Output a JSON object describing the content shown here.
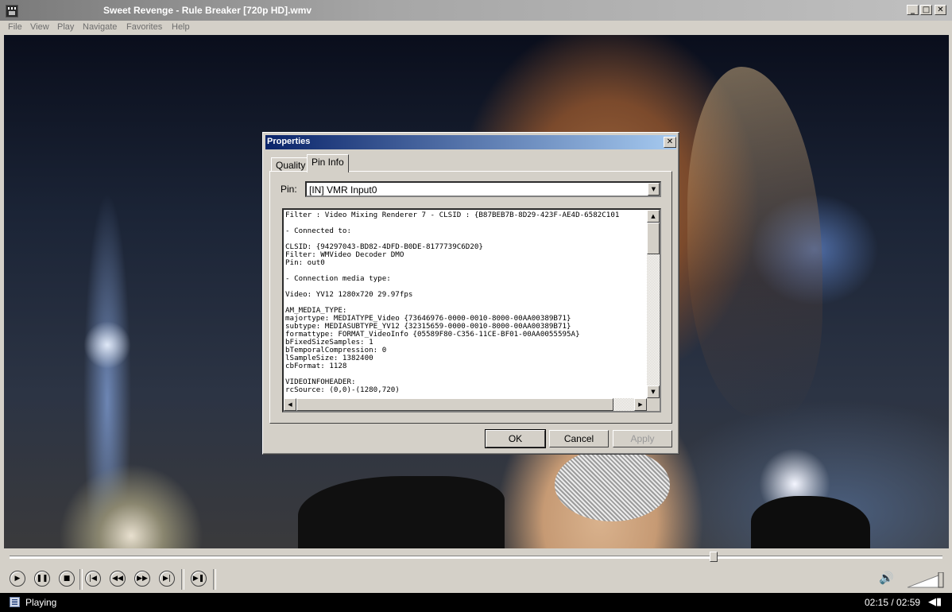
{
  "window": {
    "title": "Sweet Revenge - Rule Breaker [720p HD].wmv",
    "minimize_glyph": "_",
    "maximize_glyph": "□",
    "close_glyph": "✕"
  },
  "menu": [
    "File",
    "View",
    "Play",
    "Navigate",
    "Favorites",
    "Help"
  ],
  "dialog": {
    "title": "Properties",
    "close_glyph": "✕",
    "tabs": [
      "Quality",
      "Pin Info"
    ],
    "active_tab": "Pin Info",
    "pin_label": "Pin:",
    "pin_value": "[IN] VMR Input0",
    "info_text": "Filter : Video Mixing Renderer 7 - CLSID : {B87BEB7B-8D29-423F-AE4D-6582C101\n\n- Connected to:\n\nCLSID: {94297043-BD82-4DFD-B0DE-8177739C6D20}\nFilter: WMVideo Decoder DMO\nPin: out0\n\n- Connection media type:\n\nVideo: YV12 1280x720 29.97fps\n\nAM_MEDIA_TYPE:\nmajortype: MEDIATYPE_Video {73646976-0000-0010-8000-00AA00389B71}\nsubtype: MEDIASUBTYPE_YV12 {32315659-0000-0010-8000-00AA00389B71}\nformattype: FORMAT_VideoInfo {05589F80-C356-11CE-BF01-00AA0055595A}\nbFixedSizeSamples: 1\nbTemporalCompression: 0\nlSampleSize: 1382400\ncbFormat: 1128\n\nVIDEOINFOHEADER:\nrcSource: (0,0)-(1280,720)",
    "buttons": {
      "ok": "OK",
      "cancel": "Cancel",
      "apply": "Apply"
    },
    "apply_enabled": false
  },
  "player": {
    "seek_progress_fraction": 0.755,
    "controls": {
      "play": "▶",
      "pause": "❚❚",
      "stop": "■",
      "prev": "|◀",
      "rewind": "◀◀",
      "forward": "▶▶",
      "next": "▶|",
      "frame_step": "▶❚"
    },
    "volume_icon": "🔊"
  },
  "status": {
    "text": "Playing",
    "time": "02:15 / 02:59",
    "speaker_icon": "◀▮"
  },
  "icons": {
    "app": "media-player-icon",
    "status": "file-icon",
    "scroll_up": "▲",
    "scroll_down": "▼",
    "scroll_left": "◀",
    "scroll_right": "▶",
    "dropdown": "▼"
  }
}
